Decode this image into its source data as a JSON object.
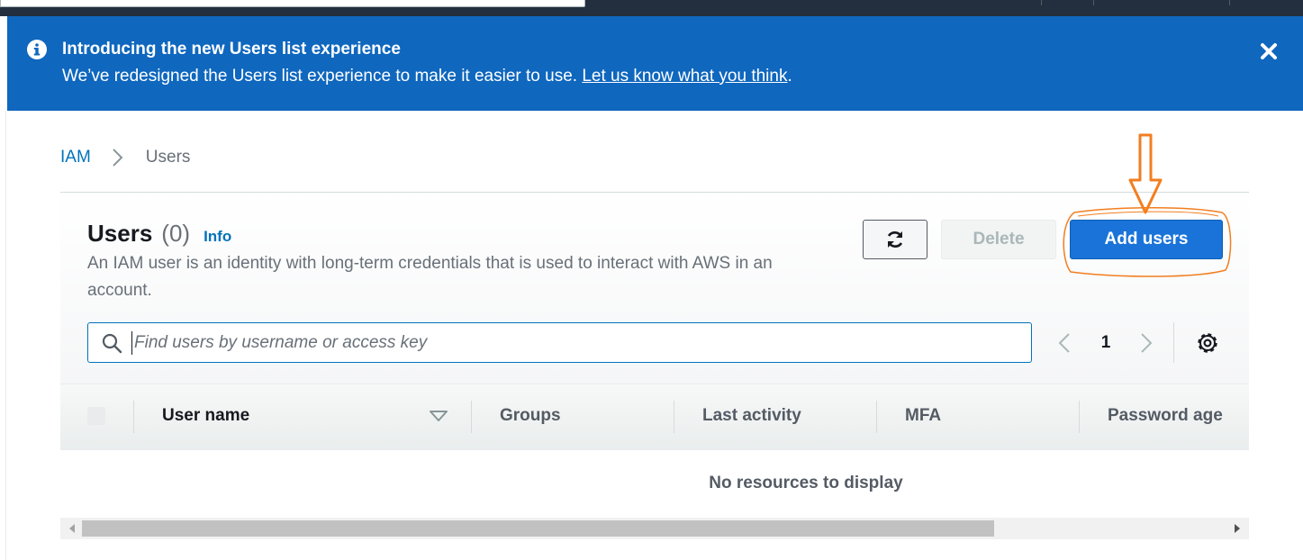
{
  "flash": {
    "title": "Introducing the new Users list experience",
    "body": "We’ve redesigned the Users list experience to make it easier to use. ",
    "link": "Let us know what you think",
    "trailing": ".",
    "color": "#0f67be"
  },
  "breadcrumb": {
    "items": [
      "IAM",
      "Users"
    ]
  },
  "users": {
    "title": "Users",
    "count": "(0)",
    "info": "Info",
    "description": "An IAM user is an identity with long-term credentials that is used to interact with AWS in an account."
  },
  "actions": {
    "refresh_icon": "refresh-icon",
    "delete_label": "Delete",
    "add_label": "Add users",
    "add_color": "#1a73d9"
  },
  "search": {
    "placeholder": "Find users by username or access key",
    "value": ""
  },
  "pagination": {
    "current_page": "1"
  },
  "table": {
    "columns": [
      "User name",
      "Groups",
      "Last activity",
      "MFA",
      "Password age"
    ],
    "sorted_column": "User name",
    "empty_message": "No resources to display"
  },
  "annotation": {
    "color": "#f27e20"
  }
}
